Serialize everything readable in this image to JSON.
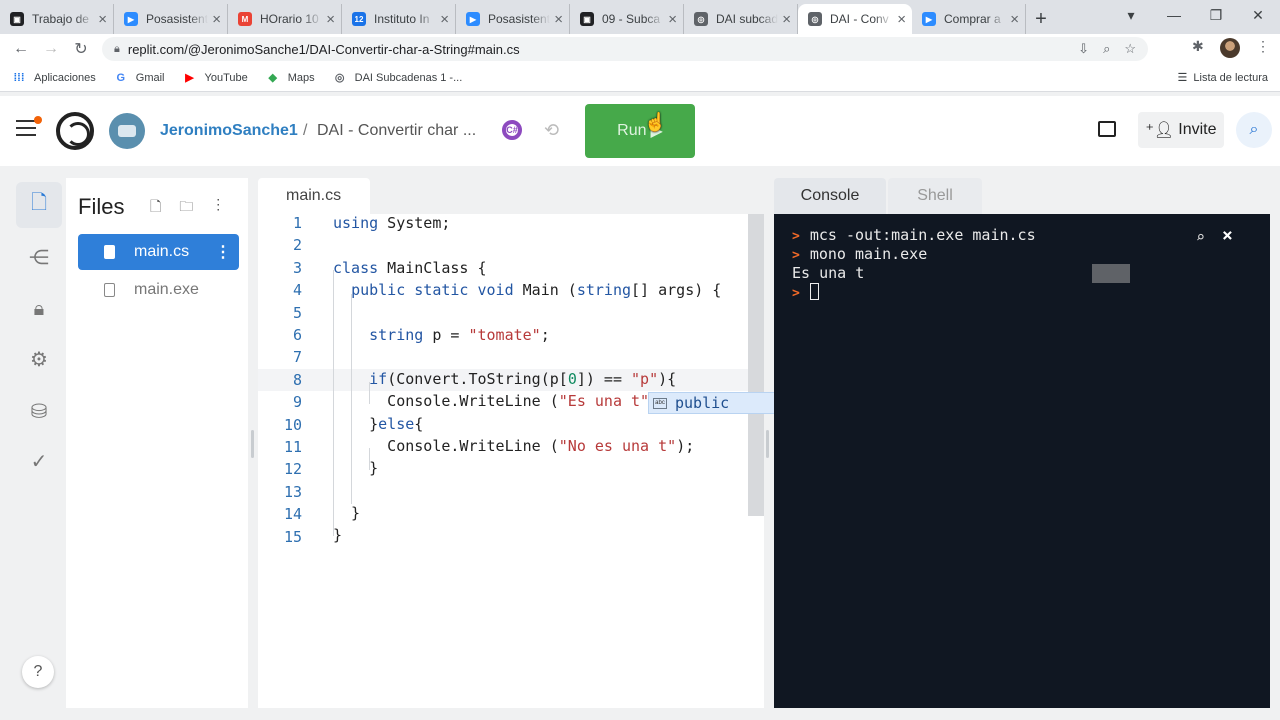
{
  "browser": {
    "tabs": [
      {
        "title": "Trabajo de",
        "color": "#202124",
        "glyph": "▣"
      },
      {
        "title": "Posasistent",
        "color": "#2d8cff",
        "glyph": "▶"
      },
      {
        "title": "HOrario 10",
        "color": "#ea4335",
        "glyph": "M"
      },
      {
        "title": "Instituto In",
        "color": "#1a73e8",
        "glyph": "12"
      },
      {
        "title": "Posasistent",
        "color": "#2d8cff",
        "glyph": "▶"
      },
      {
        "title": "09 - Subca",
        "color": "#202124",
        "glyph": "▣"
      },
      {
        "title": "DAI subcad",
        "color": "#5f6368",
        "glyph": "◎"
      },
      {
        "title": "DAI - Conv",
        "color": "#5f6368",
        "glyph": "◎"
      },
      {
        "title": "Comprar a",
        "color": "#2d8cff",
        "glyph": "▶"
      }
    ],
    "active_tab_index": 7,
    "url": "replit.com/@JeronimoSanche1/DAI-Convertir-char-a-String#main.cs",
    "bookmarks": [
      {
        "label": "Aplicaciones",
        "icon": "apps-icon",
        "color": "#1a73e8"
      },
      {
        "label": "Gmail",
        "icon": "google-icon",
        "color": "#4285f4"
      },
      {
        "label": "YouTube",
        "icon": "youtube-icon",
        "color": "#ff0000"
      },
      {
        "label": "Maps",
        "icon": "maps-icon",
        "color": "#34a853"
      },
      {
        "label": "DAI Subcadenas 1 -...",
        "icon": "replit-icon",
        "color": "#5f6368"
      }
    ],
    "reading_list": "Lista de lectura"
  },
  "header": {
    "username": "JeronimoSanche1",
    "separator": "/",
    "repl_name": "DAI - Convertir char ...",
    "language_badge": "C#",
    "run_label": "Run",
    "invite_label": "Invite",
    "run_color": "#46a94a"
  },
  "files": {
    "title": "Files",
    "items": [
      {
        "name": "main.cs",
        "active": true
      },
      {
        "name": "main.exe",
        "active": false
      }
    ]
  },
  "editor": {
    "tab": "main.cs",
    "line_numbers": [
      "1",
      "2",
      "3",
      "4",
      "5",
      "6",
      "7",
      "8",
      "9",
      "10",
      "11",
      "12",
      "13",
      "14",
      "15"
    ],
    "autocomplete_item": "public"
  },
  "console": {
    "tabs": [
      "Console",
      "Shell"
    ],
    "lines": [
      {
        "prompt": ">",
        "text": "mcs -out:main.exe main.cs"
      },
      {
        "prompt": ">",
        "text": "mono main.exe"
      },
      {
        "prompt": "",
        "text": "Es una t"
      }
    ],
    "prompt_symbol": ">"
  },
  "help_label": "?"
}
